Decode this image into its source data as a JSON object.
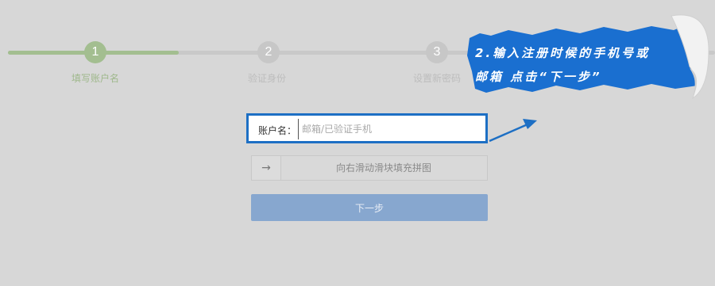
{
  "steps": [
    {
      "number": "1",
      "label": "填写账户名",
      "state": "done"
    },
    {
      "number": "2",
      "label": "验证身份",
      "state": "pending"
    },
    {
      "number": "3",
      "label": "设置新密码",
      "state": "pending"
    }
  ],
  "form": {
    "account_label": "账户名：",
    "account_placeholder": "邮箱/已验证手机",
    "slider_arrow": "→",
    "slider_text": "向右滑动滑块填充拼图",
    "next_label": "下一步"
  },
  "annotation": {
    "line1": "2.输入注册时候的手机号或",
    "line2": "邮箱  点击“下一步”",
    "banner_color": "#1a6fd0",
    "highlight_color": "#1d6fc4"
  },
  "colors": {
    "step_done": "#a3be90",
    "step_pending": "#c7c7c7",
    "button": "#87a7cf"
  }
}
